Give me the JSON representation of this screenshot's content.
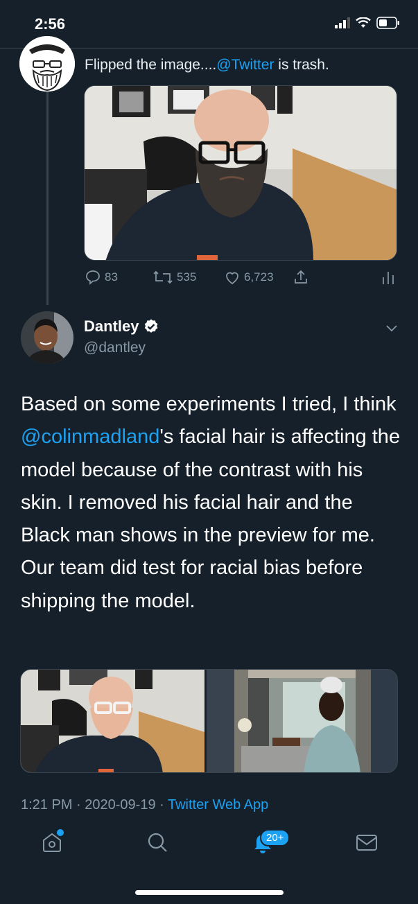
{
  "status": {
    "time": "2:56"
  },
  "previous_tweet": {
    "text_before": "Flipped the image....",
    "mention": "@Twitter",
    "text_after": " is trash.",
    "actions": {
      "replies": "83",
      "retweets": "535",
      "likes": "6,723"
    }
  },
  "tweet": {
    "name": "Dantley",
    "handle": "@dantley",
    "body_before": "Based on some experiments I tried, I think ",
    "mention": "@colinmadland",
    "body_after": "'s facial hair is affecting the model because of the contrast with his skin. I removed his facial hair and the Black man shows in the preview for me. Our team did test for racial bias before shipping the model.",
    "time": "1:21 PM",
    "sep1": " · ",
    "date": "2020-09-19",
    "sep2": " · ",
    "app": "Twitter Web App"
  },
  "tabbar": {
    "notifications_badge": "20+"
  },
  "colors": {
    "background": "#15202b",
    "accent": "#1da1f2",
    "muted": "#8899a6",
    "divider": "#38444d"
  }
}
